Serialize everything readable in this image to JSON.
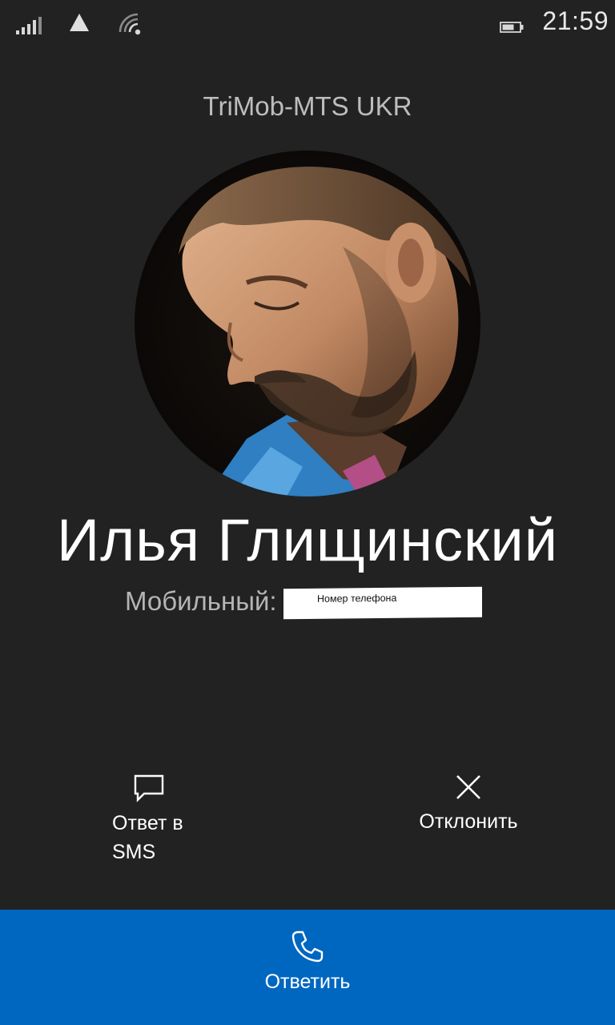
{
  "status_bar": {
    "time": "21:59",
    "icons": [
      "signal-icon",
      "triangle-icon",
      "wifi-icon",
      "battery-icon"
    ]
  },
  "operator": "TriMob-MTS UKR",
  "caller": {
    "name": "Илья Глищинский",
    "number_label": "Мобильный:",
    "number_value": "Номер телефона"
  },
  "actions": {
    "sms_label_line1": "Ответ в",
    "sms_label_line2": "SMS",
    "decline_label": "Отклонить",
    "answer_label": "Ответить"
  },
  "colors": {
    "background": "#222222",
    "answer_bar": "#0067c0",
    "text": "#ffffff"
  }
}
